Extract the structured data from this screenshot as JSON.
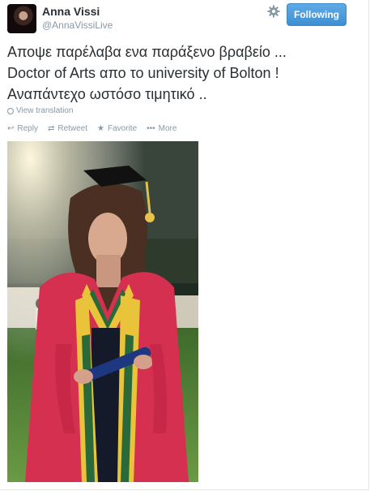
{
  "user": {
    "name": "Anna Vissi",
    "handle": "@AnnaVissiLive"
  },
  "follow_button": {
    "label": "Following"
  },
  "tweet": {
    "line1": "Αποψε παρέλαβα ενα παράξενο βραβείο ...",
    "line2": "Doctor of Arts απο το university of Bolton !",
    "line3": "Αναπάντεχο ωστόσο τιμητικό .."
  },
  "translation_link": "View translation",
  "actions": [
    {
      "label": "Reply",
      "icon": "reply-icon"
    },
    {
      "label": "Retweet",
      "icon": "retweet-icon"
    },
    {
      "label": "Favorite",
      "icon": "star-icon"
    },
    {
      "label": "More",
      "icon": "more-icon"
    }
  ],
  "colors": {
    "follow_button": "#4a97d8",
    "text": "#292f33",
    "muted": "#8899a6"
  }
}
